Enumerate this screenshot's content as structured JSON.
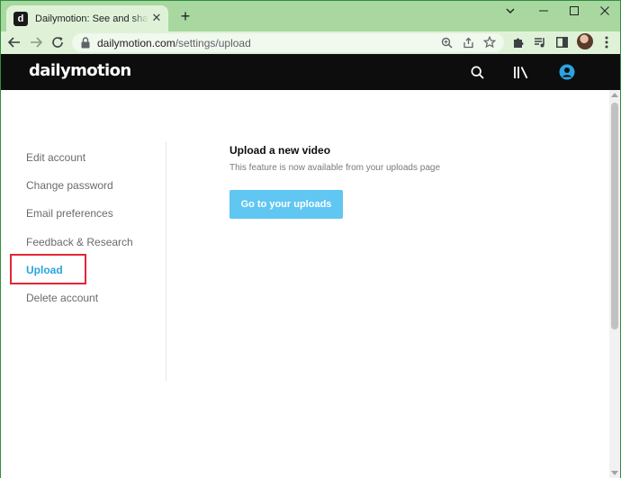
{
  "browser": {
    "tab": {
      "favicon_letter": "d",
      "title": "Dailymotion: See and share the w",
      "close_glyph": "✕"
    },
    "new_tab_glyph": "+",
    "window_controls": {
      "minimize": "⌄",
      "restore": "—",
      "maximize": "☐",
      "close": "✕"
    },
    "address": {
      "domain": "dailymotion.com",
      "path": "/settings/upload"
    },
    "icons": [
      "back-icon",
      "forward-icon",
      "reload-icon",
      "lock-icon",
      "zoom-icon",
      "share-icon",
      "bookmark-star-icon",
      "extensions-icon",
      "media-icon",
      "sidepanel-icon",
      "profile-avatar",
      "menu-icon"
    ]
  },
  "site": {
    "logo": "dailymotion",
    "header_icons": [
      "search-icon",
      "library-icon",
      "account-icon"
    ],
    "colors": {
      "header_bg": "#0d0d0d",
      "accent": "#2aa3e0",
      "button": "#60c6f2",
      "highlight": "#e32636"
    }
  },
  "settings_nav": {
    "items": [
      {
        "label": "Edit account",
        "active": false
      },
      {
        "label": "Change password",
        "active": false
      },
      {
        "label": "Email preferences",
        "active": false
      },
      {
        "label": "Feedback & Research",
        "active": false
      },
      {
        "label": "Upload",
        "active": true
      },
      {
        "label": "Delete account",
        "active": false
      }
    ]
  },
  "main": {
    "title": "Upload a new video",
    "subtitle": "This feature is now available from your uploads page",
    "button_label": "Go to your uploads"
  }
}
